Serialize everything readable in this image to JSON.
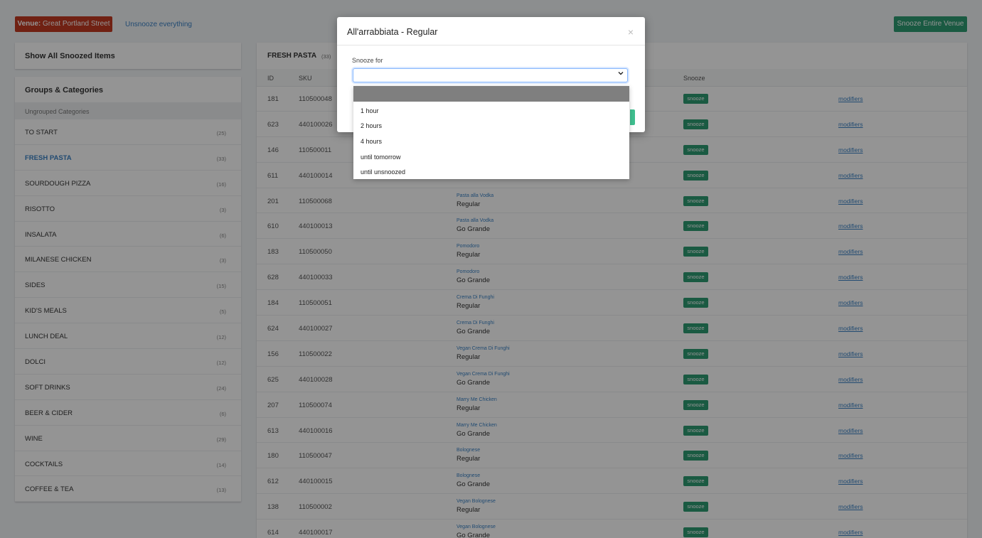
{
  "header": {
    "venue_prefix": "Venue:",
    "venue_name": "Great Portland Street",
    "unsnooze_all": "Unsnooze everything",
    "snooze_venue": "Snooze Entire Venue"
  },
  "sidebar": {
    "show_snoozed": "Show All Snoozed Items",
    "groups_title": "Groups & Categories",
    "ungrouped": "Ungrouped Categories",
    "categories": [
      {
        "name": "TO START",
        "count": "(25)"
      },
      {
        "name": "FRESH PASTA",
        "count": "(33)"
      },
      {
        "name": "SOURDOUGH PIZZA",
        "count": "(16)"
      },
      {
        "name": "RISOTTO",
        "count": "(3)"
      },
      {
        "name": "INSALATA",
        "count": "(6)"
      },
      {
        "name": "MILANESE CHICKEN",
        "count": "(3)"
      },
      {
        "name": "SIDES",
        "count": "(15)"
      },
      {
        "name": "KID'S MEALS",
        "count": "(5)"
      },
      {
        "name": "LUNCH DEAL",
        "count": "(12)"
      },
      {
        "name": "DOLCI",
        "count": "(12)"
      },
      {
        "name": "SOFT DRINKS",
        "count": "(24)"
      },
      {
        "name": "BEER & CIDER",
        "count": "(6)"
      },
      {
        "name": "WINE",
        "count": "(29)"
      },
      {
        "name": "COCKTAILS",
        "count": "(14)"
      },
      {
        "name": "COFFEE & TEA",
        "count": "(13)"
      }
    ]
  },
  "main": {
    "title": "FRESH PASTA",
    "count": "(33)",
    "columns": {
      "id": "ID",
      "sku": "SKU",
      "snooze": "Snooze"
    },
    "snooze_label": "snooze",
    "modifiers_label": "modifiers",
    "rows": [
      {
        "id": "181",
        "sku": "110500048",
        "item": "",
        "variant": ""
      },
      {
        "id": "623",
        "sku": "440100026",
        "item": "",
        "variant": ""
      },
      {
        "id": "146",
        "sku": "110500011",
        "item": "",
        "variant": ""
      },
      {
        "id": "611",
        "sku": "440100014",
        "item": "",
        "variant": ""
      },
      {
        "id": "201",
        "sku": "110500068",
        "item": "Pasta alla Vodka",
        "variant": "Regular"
      },
      {
        "id": "610",
        "sku": "440100013",
        "item": "Pasta alla Vodka",
        "variant": "Go Grande"
      },
      {
        "id": "183",
        "sku": "110500050",
        "item": "Pomodoro",
        "variant": "Regular"
      },
      {
        "id": "628",
        "sku": "440100033",
        "item": "Pomodoro",
        "variant": "Go Grande"
      },
      {
        "id": "184",
        "sku": "110500051",
        "item": "Crema Di Funghi",
        "variant": "Regular"
      },
      {
        "id": "624",
        "sku": "440100027",
        "item": "Crema Di Funghi",
        "variant": "Go Grande"
      },
      {
        "id": "156",
        "sku": "110500022",
        "item": "Vegan Crema Di Funghi",
        "variant": "Regular"
      },
      {
        "id": "625",
        "sku": "440100028",
        "item": "Vegan Crema Di Funghi",
        "variant": "Go Grande"
      },
      {
        "id": "207",
        "sku": "110500074",
        "item": "Marry Me Chicken",
        "variant": "Regular"
      },
      {
        "id": "613",
        "sku": "440100016",
        "item": "Marry Me Chicken",
        "variant": "Go Grande"
      },
      {
        "id": "180",
        "sku": "110500047",
        "item": "Bolognese",
        "variant": "Regular"
      },
      {
        "id": "612",
        "sku": "440100015",
        "item": "Bolognese",
        "variant": "Go Grande"
      },
      {
        "id": "138",
        "sku": "110500002",
        "item": "Vegan Bolognese",
        "variant": "Regular"
      },
      {
        "id": "614",
        "sku": "440100017",
        "item": "Vegan Bolognese",
        "variant": "Go Grande"
      }
    ]
  },
  "modal": {
    "title": "All'arrabbiata - Regular",
    "close": "×",
    "snooze_for_label": "Snooze for",
    "select_value": "",
    "options": [
      "1 hour",
      "2 hours",
      "4 hours",
      "until tomorrow",
      "until unsnoozed"
    ]
  }
}
